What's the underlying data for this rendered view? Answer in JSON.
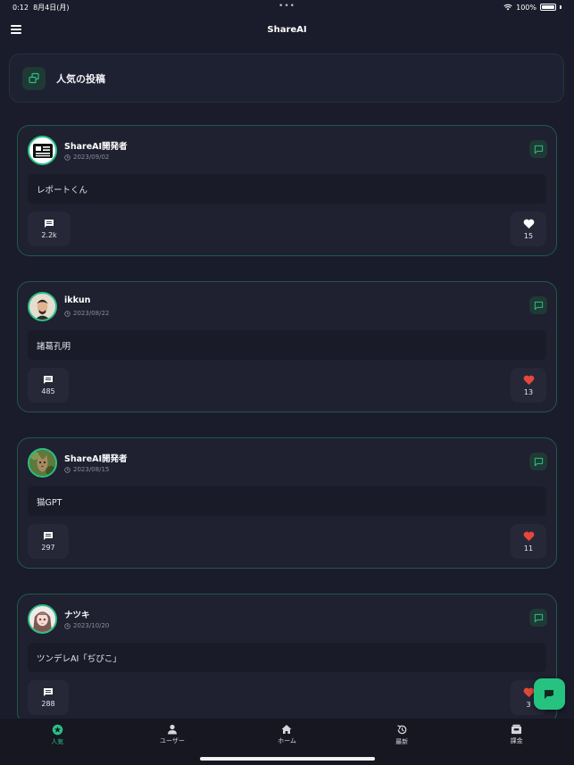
{
  "status_bar": {
    "time": "0:12",
    "date": "8月4日(月)",
    "dots": "•••",
    "battery": "100%"
  },
  "nav": {
    "title": "ShareAI"
  },
  "section": {
    "title": "人気の投稿"
  },
  "posts": [
    {
      "author": "ShareAI開発者",
      "date": "2023/09/02",
      "body": "レポートくん",
      "comments": "2.2k",
      "likes": "15",
      "liked": false,
      "avatar": "newspaper-icon"
    },
    {
      "author": "ikkun",
      "date": "2023/08/22",
      "body": "諸葛孔明",
      "comments": "485",
      "likes": "13",
      "liked": true,
      "avatar": "portrait-avatar"
    },
    {
      "author": "ShareAI開発者",
      "date": "2023/08/15",
      "body": "猫GPT",
      "comments": "297",
      "likes": "11",
      "liked": true,
      "avatar": "cat-avatar"
    },
    {
      "author": "ナツキ",
      "date": "2023/10/20",
      "body": "ツンデレAI「ぢぴこ」",
      "comments": "288",
      "likes": "3",
      "liked": true,
      "avatar": "anime-avatar"
    }
  ],
  "tabs": [
    {
      "label": "人気",
      "icon": "star-badge-icon",
      "active": true
    },
    {
      "label": "ユーザー",
      "icon": "person-icon",
      "active": false
    },
    {
      "label": "ホーム",
      "icon": "home-icon",
      "active": false
    },
    {
      "label": "最新",
      "icon": "history-icon",
      "active": false
    },
    {
      "label": "課金",
      "icon": "wallet-icon",
      "active": false
    }
  ],
  "colors": {
    "accent": "#2bbf86",
    "like_active": "#e5483a",
    "background": "#1b1c2b",
    "card_border": "#1f5a4a"
  }
}
